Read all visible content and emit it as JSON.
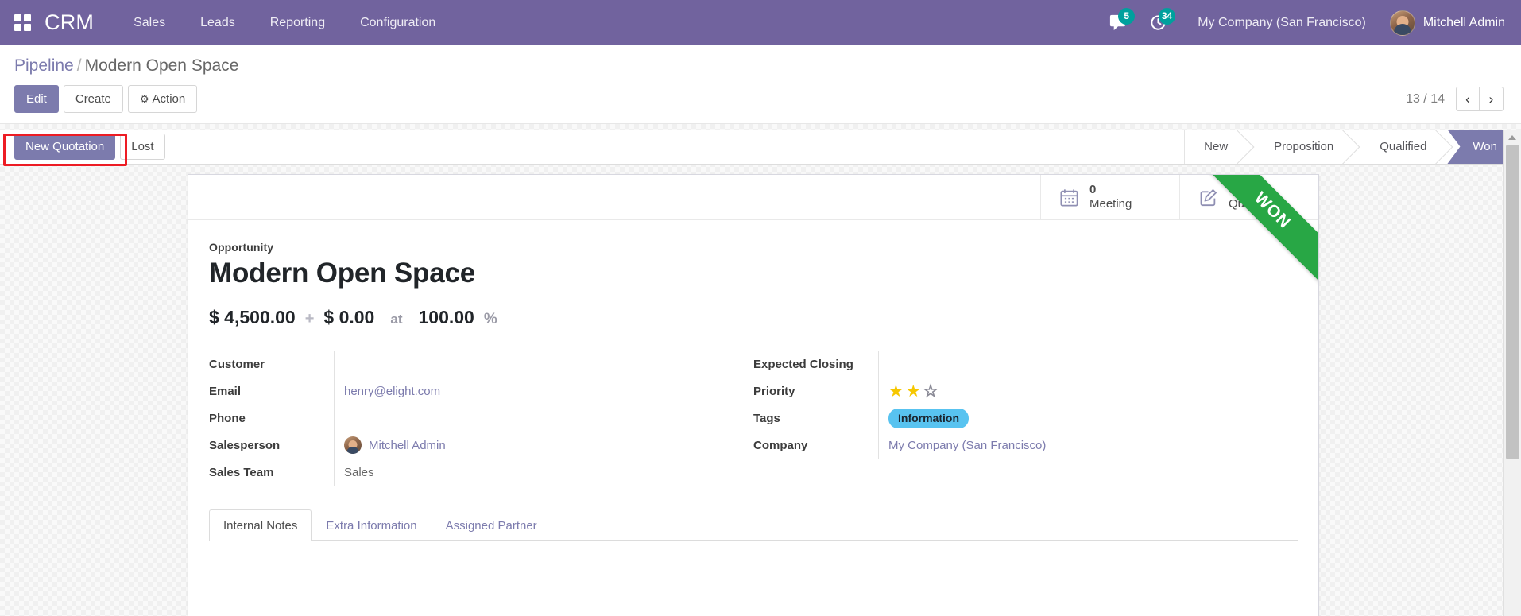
{
  "navbar": {
    "apps_icon": "apps-grid-icon",
    "brand": "CRM",
    "menu": [
      {
        "label": "Sales"
      },
      {
        "label": "Leads"
      },
      {
        "label": "Reporting"
      },
      {
        "label": "Configuration"
      }
    ],
    "messages": {
      "icon": "comment-icon",
      "count": "5"
    },
    "activities": {
      "icon": "clock-activity-icon",
      "count": "34"
    },
    "company": "My Company (San Francisco)",
    "user": "Mitchell Admin"
  },
  "control_panel": {
    "breadcrumb": {
      "parent": "Pipeline",
      "separator": "/",
      "current": "Modern Open Space"
    },
    "buttons": {
      "edit": "Edit",
      "create": "Create",
      "action": "Action",
      "action_icon": "gear-icon"
    },
    "pager": {
      "count": "13 / 14",
      "prev_icon": "chevron-left-icon",
      "next_icon": "chevron-right-icon",
      "prev_glyph": "‹",
      "next_glyph": "›"
    }
  },
  "statusbar": {
    "buttons": [
      {
        "label": "New Quotation",
        "primary": true,
        "highlighted": true
      },
      {
        "label": "Lost",
        "primary": false,
        "highlighted": false
      }
    ],
    "stages": [
      {
        "label": "New",
        "active": false
      },
      {
        "label": "Proposition",
        "active": false
      },
      {
        "label": "Qualified",
        "active": false
      },
      {
        "label": "Won",
        "active": true
      }
    ]
  },
  "form": {
    "stat_buttons": [
      {
        "icon": "calendar-icon",
        "value": "0",
        "label": "Meeting"
      },
      {
        "icon": "pencil-square-icon",
        "value": "0",
        "label": "Quotations"
      }
    ],
    "ribbon": "WON",
    "subtitle": "Opportunity",
    "title": "Modern Open Space",
    "amount": {
      "expected_revenue": "$ 4,500.00",
      "operator": "+",
      "recurring_revenue": "$ 0.00",
      "at": "at",
      "probability": "100.00",
      "percent_symbol": "%"
    },
    "left_fields": [
      {
        "label": "Customer",
        "value": "",
        "type": "text"
      },
      {
        "label": "Email",
        "value": "henry@elight.com",
        "type": "link"
      },
      {
        "label": "Phone",
        "value": "",
        "type": "text"
      },
      {
        "label": "Salesperson",
        "value": "Mitchell Admin",
        "type": "avatar"
      },
      {
        "label": "Sales Team",
        "value": "Sales",
        "type": "text"
      }
    ],
    "right_fields": [
      {
        "label": "Expected Closing",
        "value": "",
        "type": "text"
      },
      {
        "label": "Priority",
        "value": "",
        "type": "stars",
        "stars_filled": 2,
        "stars_total": 3
      },
      {
        "label": "Tags",
        "value": "Information",
        "type": "tag"
      },
      {
        "label": "Company",
        "value": "My Company (San Francisco)",
        "type": "link"
      }
    ],
    "tabs": [
      {
        "label": "Internal Notes",
        "active": true
      },
      {
        "label": "Extra Information",
        "active": false
      },
      {
        "label": "Assigned Partner",
        "active": false
      }
    ]
  },
  "colors": {
    "brand_purple": "#71639e",
    "accent_purple": "#7c7bad",
    "won_green": "#28a745",
    "tag_blue": "#58c3f0",
    "badge_teal": "#00a09d",
    "highlight_red": "#ed1c24",
    "star_yellow": "#f6c700"
  }
}
